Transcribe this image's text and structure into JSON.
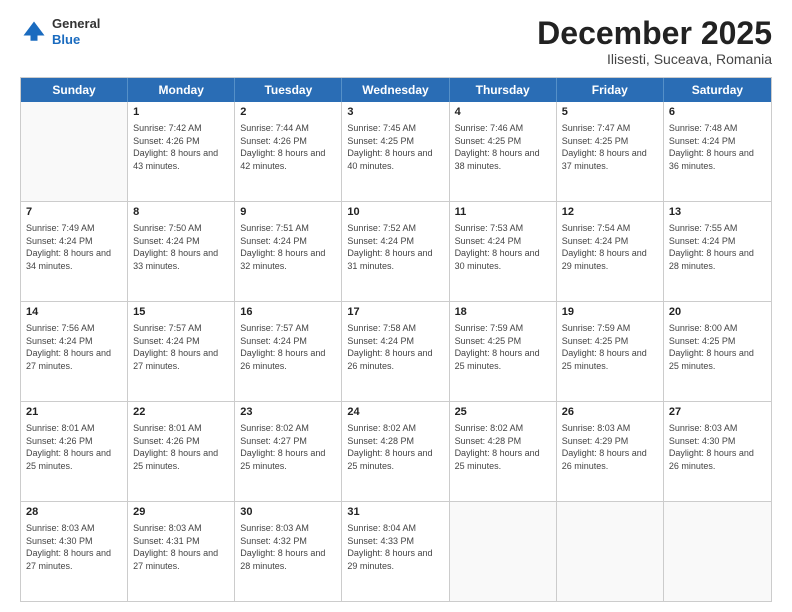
{
  "header": {
    "logo_general": "General",
    "logo_blue": "Blue",
    "month_title": "December 2025",
    "location": "Ilisesti, Suceava, Romania"
  },
  "days_of_week": [
    "Sunday",
    "Monday",
    "Tuesday",
    "Wednesday",
    "Thursday",
    "Friday",
    "Saturday"
  ],
  "weeks": [
    [
      {
        "day": "",
        "sunrise": "",
        "sunset": "",
        "daylight": ""
      },
      {
        "day": "1",
        "sunrise": "Sunrise: 7:42 AM",
        "sunset": "Sunset: 4:26 PM",
        "daylight": "Daylight: 8 hours and 43 minutes."
      },
      {
        "day": "2",
        "sunrise": "Sunrise: 7:44 AM",
        "sunset": "Sunset: 4:26 PM",
        "daylight": "Daylight: 8 hours and 42 minutes."
      },
      {
        "day": "3",
        "sunrise": "Sunrise: 7:45 AM",
        "sunset": "Sunset: 4:25 PM",
        "daylight": "Daylight: 8 hours and 40 minutes."
      },
      {
        "day": "4",
        "sunrise": "Sunrise: 7:46 AM",
        "sunset": "Sunset: 4:25 PM",
        "daylight": "Daylight: 8 hours and 38 minutes."
      },
      {
        "day": "5",
        "sunrise": "Sunrise: 7:47 AM",
        "sunset": "Sunset: 4:25 PM",
        "daylight": "Daylight: 8 hours and 37 minutes."
      },
      {
        "day": "6",
        "sunrise": "Sunrise: 7:48 AM",
        "sunset": "Sunset: 4:24 PM",
        "daylight": "Daylight: 8 hours and 36 minutes."
      }
    ],
    [
      {
        "day": "7",
        "sunrise": "Sunrise: 7:49 AM",
        "sunset": "Sunset: 4:24 PM",
        "daylight": "Daylight: 8 hours and 34 minutes."
      },
      {
        "day": "8",
        "sunrise": "Sunrise: 7:50 AM",
        "sunset": "Sunset: 4:24 PM",
        "daylight": "Daylight: 8 hours and 33 minutes."
      },
      {
        "day": "9",
        "sunrise": "Sunrise: 7:51 AM",
        "sunset": "Sunset: 4:24 PM",
        "daylight": "Daylight: 8 hours and 32 minutes."
      },
      {
        "day": "10",
        "sunrise": "Sunrise: 7:52 AM",
        "sunset": "Sunset: 4:24 PM",
        "daylight": "Daylight: 8 hours and 31 minutes."
      },
      {
        "day": "11",
        "sunrise": "Sunrise: 7:53 AM",
        "sunset": "Sunset: 4:24 PM",
        "daylight": "Daylight: 8 hours and 30 minutes."
      },
      {
        "day": "12",
        "sunrise": "Sunrise: 7:54 AM",
        "sunset": "Sunset: 4:24 PM",
        "daylight": "Daylight: 8 hours and 29 minutes."
      },
      {
        "day": "13",
        "sunrise": "Sunrise: 7:55 AM",
        "sunset": "Sunset: 4:24 PM",
        "daylight": "Daylight: 8 hours and 28 minutes."
      }
    ],
    [
      {
        "day": "14",
        "sunrise": "Sunrise: 7:56 AM",
        "sunset": "Sunset: 4:24 PM",
        "daylight": "Daylight: 8 hours and 27 minutes."
      },
      {
        "day": "15",
        "sunrise": "Sunrise: 7:57 AM",
        "sunset": "Sunset: 4:24 PM",
        "daylight": "Daylight: 8 hours and 27 minutes."
      },
      {
        "day": "16",
        "sunrise": "Sunrise: 7:57 AM",
        "sunset": "Sunset: 4:24 PM",
        "daylight": "Daylight: 8 hours and 26 minutes."
      },
      {
        "day": "17",
        "sunrise": "Sunrise: 7:58 AM",
        "sunset": "Sunset: 4:24 PM",
        "daylight": "Daylight: 8 hours and 26 minutes."
      },
      {
        "day": "18",
        "sunrise": "Sunrise: 7:59 AM",
        "sunset": "Sunset: 4:25 PM",
        "daylight": "Daylight: 8 hours and 25 minutes."
      },
      {
        "day": "19",
        "sunrise": "Sunrise: 7:59 AM",
        "sunset": "Sunset: 4:25 PM",
        "daylight": "Daylight: 8 hours and 25 minutes."
      },
      {
        "day": "20",
        "sunrise": "Sunrise: 8:00 AM",
        "sunset": "Sunset: 4:25 PM",
        "daylight": "Daylight: 8 hours and 25 minutes."
      }
    ],
    [
      {
        "day": "21",
        "sunrise": "Sunrise: 8:01 AM",
        "sunset": "Sunset: 4:26 PM",
        "daylight": "Daylight: 8 hours and 25 minutes."
      },
      {
        "day": "22",
        "sunrise": "Sunrise: 8:01 AM",
        "sunset": "Sunset: 4:26 PM",
        "daylight": "Daylight: 8 hours and 25 minutes."
      },
      {
        "day": "23",
        "sunrise": "Sunrise: 8:02 AM",
        "sunset": "Sunset: 4:27 PM",
        "daylight": "Daylight: 8 hours and 25 minutes."
      },
      {
        "day": "24",
        "sunrise": "Sunrise: 8:02 AM",
        "sunset": "Sunset: 4:28 PM",
        "daylight": "Daylight: 8 hours and 25 minutes."
      },
      {
        "day": "25",
        "sunrise": "Sunrise: 8:02 AM",
        "sunset": "Sunset: 4:28 PM",
        "daylight": "Daylight: 8 hours and 25 minutes."
      },
      {
        "day": "26",
        "sunrise": "Sunrise: 8:03 AM",
        "sunset": "Sunset: 4:29 PM",
        "daylight": "Daylight: 8 hours and 26 minutes."
      },
      {
        "day": "27",
        "sunrise": "Sunrise: 8:03 AM",
        "sunset": "Sunset: 4:30 PM",
        "daylight": "Daylight: 8 hours and 26 minutes."
      }
    ],
    [
      {
        "day": "28",
        "sunrise": "Sunrise: 8:03 AM",
        "sunset": "Sunset: 4:30 PM",
        "daylight": "Daylight: 8 hours and 27 minutes."
      },
      {
        "day": "29",
        "sunrise": "Sunrise: 8:03 AM",
        "sunset": "Sunset: 4:31 PM",
        "daylight": "Daylight: 8 hours and 27 minutes."
      },
      {
        "day": "30",
        "sunrise": "Sunrise: 8:03 AM",
        "sunset": "Sunset: 4:32 PM",
        "daylight": "Daylight: 8 hours and 28 minutes."
      },
      {
        "day": "31",
        "sunrise": "Sunrise: 8:04 AM",
        "sunset": "Sunset: 4:33 PM",
        "daylight": "Daylight: 8 hours and 29 minutes."
      },
      {
        "day": "",
        "sunrise": "",
        "sunset": "",
        "daylight": ""
      },
      {
        "day": "",
        "sunrise": "",
        "sunset": "",
        "daylight": ""
      },
      {
        "day": "",
        "sunrise": "",
        "sunset": "",
        "daylight": ""
      }
    ]
  ]
}
